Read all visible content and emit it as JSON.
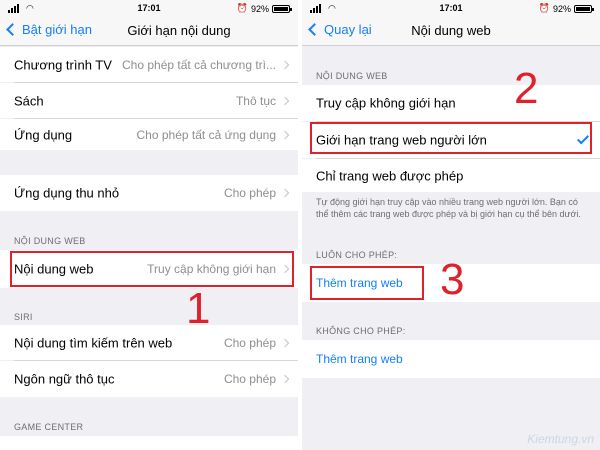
{
  "left": {
    "status": {
      "time": "17:01",
      "battery": "92%",
      "battery_level": 0.92
    },
    "nav": {
      "back_label": "Bật giới hạn",
      "title": "Giới hạn nội dung"
    },
    "rows_top": [
      {
        "label": "Chương trình TV",
        "value": "Cho phép tất cả chương trì..."
      },
      {
        "label": "Sách",
        "value": "Thô tục"
      },
      {
        "label": "Ứng dụng",
        "value": "Cho phép tất cả ứng dụng"
      }
    ],
    "row_clips": {
      "label": "Ứng dụng thu nhỏ",
      "value": "Cho phép"
    },
    "web_header": "NỘI DUNG WEB",
    "row_web": {
      "label": "Nội dung web",
      "value": "Truy cập không giới hạn"
    },
    "siri_header": "SIRI",
    "rows_siri": [
      {
        "label": "Nội dung tìm kiếm trên web",
        "value": "Cho phép"
      },
      {
        "label": "Ngôn ngữ thô tục",
        "value": "Cho phép"
      }
    ],
    "game_header": "GAME CENTER",
    "step": "1"
  },
  "right": {
    "status": {
      "time": "17:01",
      "battery": "92%",
      "battery_level": 0.92
    },
    "nav": {
      "back_label": "Quay lại",
      "title": "Nội dung web"
    },
    "web_header": "NỘI DUNG WEB",
    "options": [
      {
        "label": "Truy cập không giới hạn",
        "checked": false
      },
      {
        "label": "Giới hạn trang web người lớn",
        "checked": true
      },
      {
        "label": "Chỉ trang web được phép",
        "checked": false
      }
    ],
    "note": "Tự động giới hạn truy cập vào nhiều trang web người lớn. Bạn có thể thêm các trang web được phép và bị giới hạn cụ thể bên dưới.",
    "allow_header": "LUÔN CHO PHÉP:",
    "allow_link": "Thêm trang web",
    "deny_header": "KHÔNG CHO PHÉP:",
    "deny_link": "Thêm trang web",
    "step2": "2",
    "step3": "3"
  },
  "watermark": "Kiemtung.vn",
  "colors": {
    "accent": "#147efb",
    "highlight": "#e0202a",
    "background": "#efeff4"
  }
}
